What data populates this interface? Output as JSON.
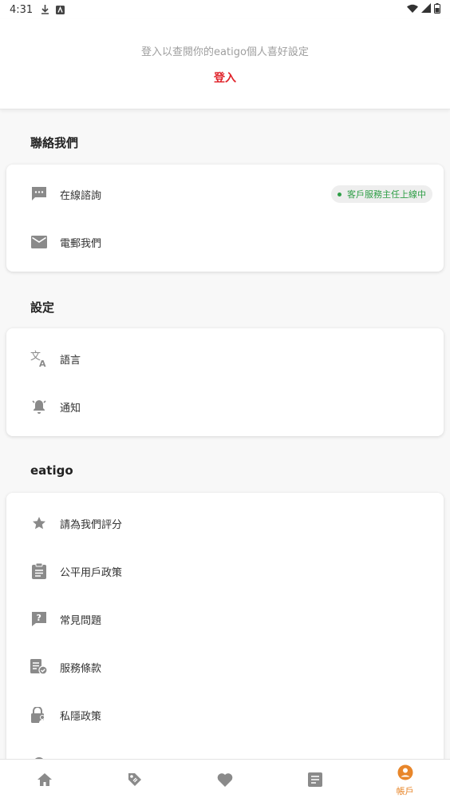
{
  "status_bar": {
    "time": "4:31"
  },
  "login": {
    "prompt": "登入以查閱你的eatigo個人喜好設定",
    "link": "登入"
  },
  "contact": {
    "title": "聯絡我們",
    "items": [
      {
        "label": "在線諮詢",
        "icon": "chat-icon",
        "badge": "客戶服務主任上線中"
      },
      {
        "label": "電郵我們",
        "icon": "mail-icon"
      }
    ]
  },
  "settings": {
    "title": "設定",
    "items": [
      {
        "label": "語言",
        "icon": "translate-icon"
      },
      {
        "label": "通知",
        "icon": "bell-icon"
      }
    ]
  },
  "eatigo": {
    "title": "eatigo",
    "items": [
      {
        "label": "請為我們評分",
        "icon": "star-icon"
      },
      {
        "label": "公平用戶政策",
        "icon": "clipboard-icon"
      },
      {
        "label": "常見問題",
        "icon": "help-icon"
      },
      {
        "label": "服務條款",
        "icon": "terms-icon"
      },
      {
        "label": "私隱政策",
        "icon": "privacy-icon"
      },
      {
        "label": "",
        "icon": "partial-item-icon"
      }
    ]
  },
  "bottom_nav": {
    "items": [
      {
        "icon": "home-icon",
        "label": ""
      },
      {
        "icon": "tag-icon",
        "label": ""
      },
      {
        "icon": "heart-icon",
        "label": ""
      },
      {
        "icon": "bookings-icon",
        "label": ""
      },
      {
        "icon": "account-icon",
        "label": "帳戶",
        "active": true
      }
    ]
  },
  "colors": {
    "accent": "#e0242b",
    "active_tab": "#e8862a",
    "online_green": "#2e9e46",
    "icon_grey": "#8a8a8a"
  }
}
